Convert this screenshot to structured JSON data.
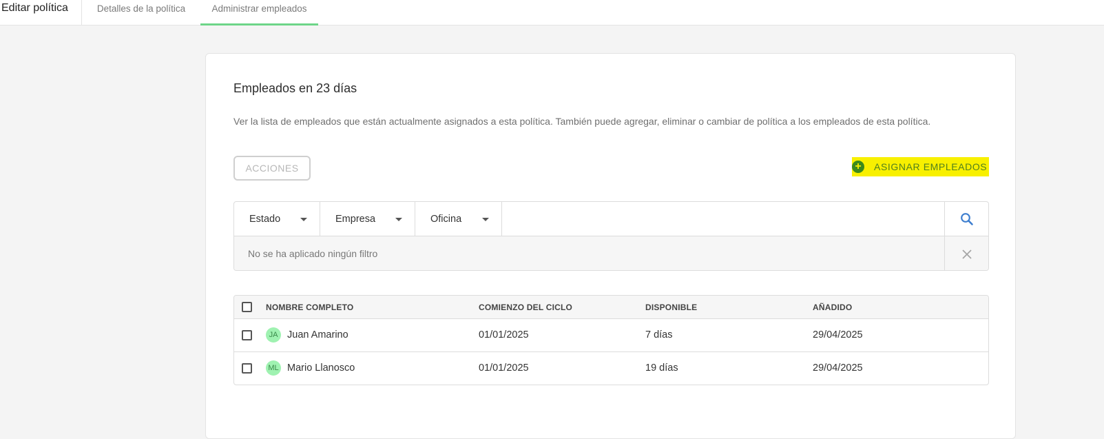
{
  "header": {
    "title": "Editar política",
    "tabs": [
      {
        "label": "Detalles de la política",
        "active": false
      },
      {
        "label": "Administrar empleados",
        "active": true
      }
    ],
    "active_tab_color": "#6dd588"
  },
  "card": {
    "title": "Empleados en 23 días",
    "description": "Ver la lista de empleados que están actualmente asignados a esta política. También puede agregar, eliminar o cambiar de política a los empleados de esta política.",
    "actions_label": "ACCIONES",
    "assign_label": "ASIGNAR EMPLEADOS",
    "assign_highlight_color": "#f8f000"
  },
  "filters": {
    "dropdowns": [
      {
        "label": "Estado"
      },
      {
        "label": "Empresa"
      },
      {
        "label": "Oficina"
      }
    ],
    "search_placeholder": "",
    "search_icon": "search-icon",
    "status_text": "No se ha aplicado ningún filtro",
    "clear_icon": "close-icon"
  },
  "table": {
    "columns": [
      "NOMBRE COMPLETO",
      "COMIENZO DEL CICLO",
      "DISPONIBLE",
      "AÑADIDO"
    ],
    "rows": [
      {
        "initials": "JA",
        "name": "Juan Amarino",
        "cycle_start": "01/01/2025",
        "available": "7 días",
        "added": "29/04/2025"
      },
      {
        "initials": "ML",
        "name": "Mario Llanosco",
        "cycle_start": "01/01/2025",
        "available": "19 días",
        "added": "29/04/2025"
      }
    ],
    "avatar_color": "#9ff2b1"
  }
}
